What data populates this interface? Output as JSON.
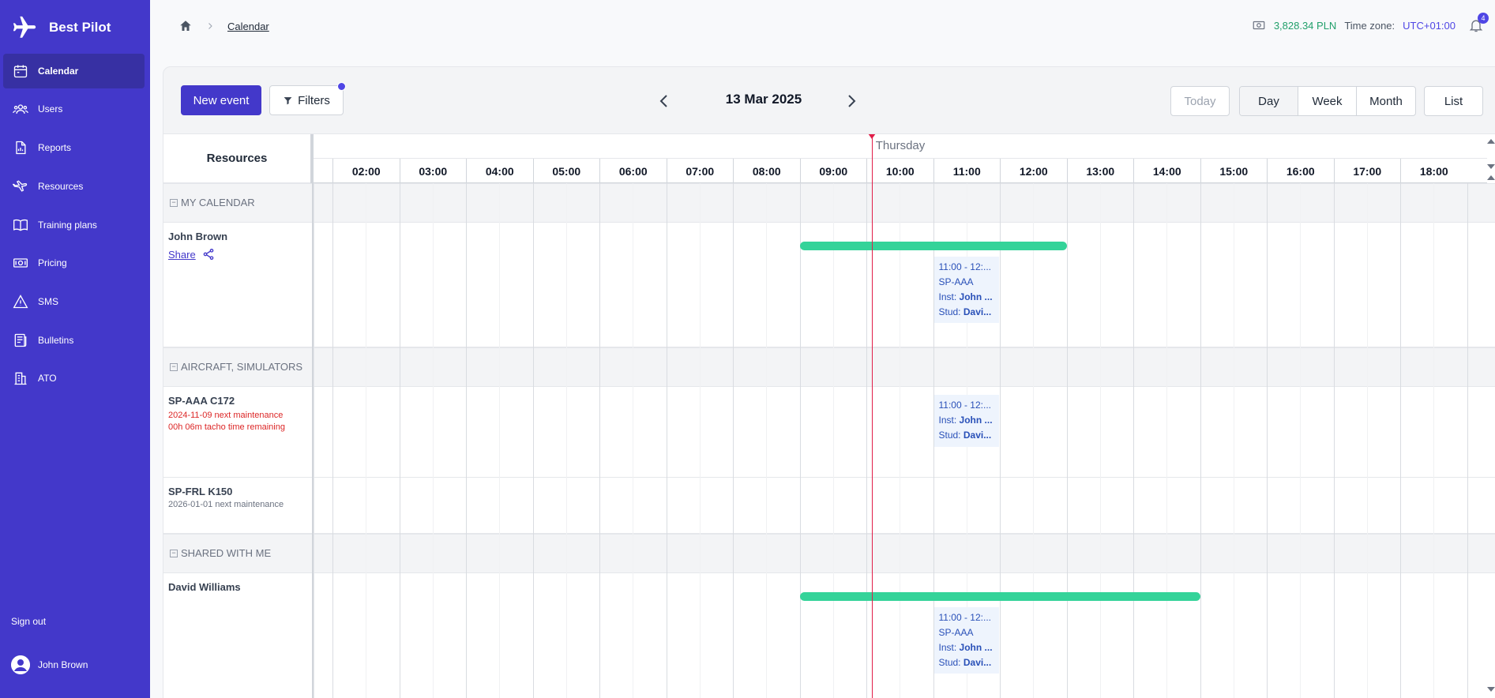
{
  "app": {
    "name": "Best Pilot"
  },
  "sidebar": {
    "items": [
      {
        "label": "Calendar",
        "icon": "calendar-icon",
        "active": true
      },
      {
        "label": "Users",
        "icon": "users-icon"
      },
      {
        "label": "Reports",
        "icon": "report-icon"
      },
      {
        "label": "Resources",
        "icon": "plane-icon"
      },
      {
        "label": "Training plans",
        "icon": "book-icon"
      },
      {
        "label": "Pricing",
        "icon": "money-icon"
      },
      {
        "label": "SMS",
        "icon": "warning-icon"
      },
      {
        "label": "Bulletins",
        "icon": "newspaper-icon"
      },
      {
        "label": "ATO",
        "icon": "building-icon"
      }
    ],
    "sign_out": "Sign out",
    "user_name": "John Brown"
  },
  "header": {
    "breadcrumb": "Calendar",
    "balance": "3,828.34 PLN",
    "timezone_label": "Time zone:",
    "timezone_value": "UTC+01:00",
    "notification_count": "4"
  },
  "toolbar": {
    "new_event": "New event",
    "filters": "Filters",
    "date": "13 Mar 2025",
    "today": "Today",
    "views": [
      "Day",
      "Week",
      "Month"
    ],
    "list": "List"
  },
  "calendar": {
    "resources_header": "Resources",
    "day_name": "Thursday",
    "hours": [
      "02:00",
      "03:00",
      "04:00",
      "05:00",
      "06:00",
      "07:00",
      "08:00",
      "09:00",
      "10:00",
      "11:00",
      "12:00",
      "13:00",
      "14:00",
      "15:00",
      "16:00",
      "17:00",
      "18:00"
    ],
    "groups": [
      "MY CALENDAR",
      "AIRCRAFT, SIMULATORS",
      "SHARED WITH ME"
    ],
    "rows": {
      "john": {
        "name": "John Brown",
        "share": "Share"
      },
      "spaaa": {
        "name": "SP-AAA C172",
        "maintenance": "2024-11-09 next maintenance",
        "tacho": "00h 06m tacho time remaining"
      },
      "spfrl": {
        "name": "SP-FRL K150",
        "maintenance": "2026-01-01 next maintenance"
      },
      "david": {
        "name": "David Williams"
      }
    },
    "events": {
      "john": {
        "time": "11:00 - 12:...",
        "aircraft": "SP-AAA",
        "inst_label": "Inst:",
        "inst": "John ...",
        "stud_label": "Stud:",
        "stud": "Davi..."
      },
      "spaaa": {
        "time": "11:00 - 12:...",
        "inst_label": "Inst:",
        "inst": "John ...",
        "stud_label": "Stud:",
        "stud": "Davi..."
      },
      "david": {
        "time": "11:00 - 12:...",
        "aircraft": "SP-AAA",
        "inst_label": "Inst:",
        "inst": "John ...",
        "stud_label": "Stud:",
        "stud": "Davi..."
      }
    },
    "availability_bars": {
      "john": {
        "start": "09:00",
        "end": "13:00"
      },
      "david": {
        "start": "09:00",
        "end": "15:00"
      }
    },
    "current_time": "10:05"
  },
  "colors": {
    "sidebar": "#4338ca",
    "accent": "#4f46e5",
    "availability": "#34d399",
    "now_line": "#e11d48",
    "balance": "#22a06b"
  }
}
